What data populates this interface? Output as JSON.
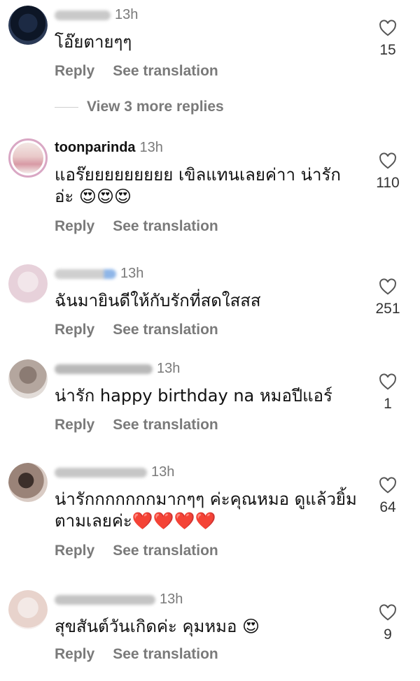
{
  "actions": {
    "reply": "Reply",
    "see_translation": "See translation"
  },
  "view_more_replies": "View 3 more replies",
  "comments": [
    {
      "username": "",
      "time": "13h",
      "text": "โอ๊ยตายๆๆ",
      "likes": "15"
    },
    {
      "username": "toonparinda",
      "time": "13h",
      "text": "แอร๊ยยยยยยยยย เขิลแทนเลยค่าา น่ารัก อ่ะ 😍😍😍",
      "likes": "110"
    },
    {
      "username": "",
      "time": "13h",
      "text": "ฉันมายินดีให้กับรักที่สดใสสส",
      "likes": "251"
    },
    {
      "username": "",
      "time": "13h",
      "text": "น่ารัก happy birthday na หมอปีแอร์",
      "likes": "1"
    },
    {
      "username": "",
      "time": "13h",
      "text": "น่ารักกกกกกกมากๆๆ ค่ะคุณหมอ ดูแล้วยิ้มตามเลยค่ะ❤️❤️❤️❤️",
      "likes": "64"
    },
    {
      "username": "",
      "time": "13h",
      "text": "สุขสันต์วันเกิดค่ะ คุมหมอ 😍",
      "likes": "9"
    }
  ]
}
